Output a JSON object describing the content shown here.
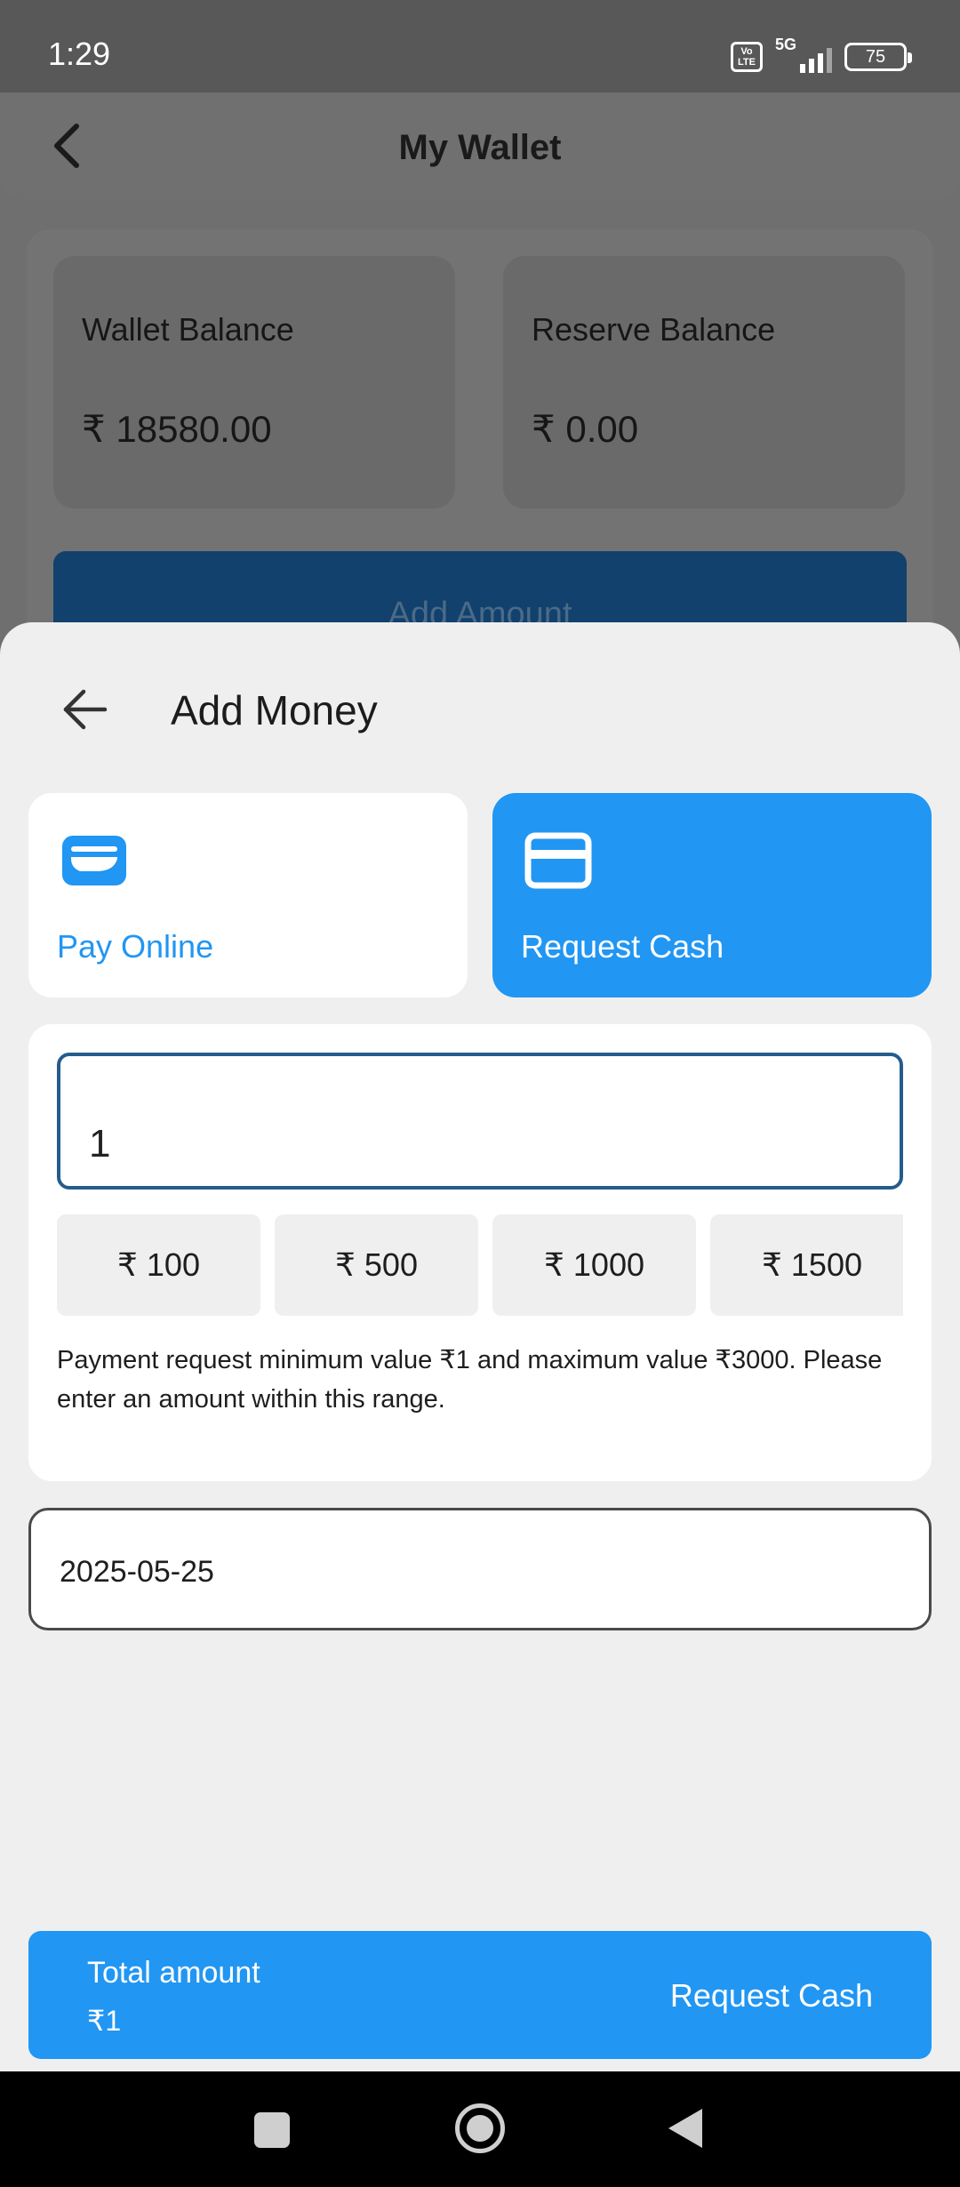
{
  "status_bar": {
    "time": "1:29",
    "volte": "Vo LTE",
    "network": "5G",
    "battery": "75"
  },
  "wallet_page": {
    "title": "My Wallet",
    "wallet_balance_label": "Wallet Balance",
    "wallet_balance_value": "₹ 18580.00",
    "reserve_balance_label": "Reserve Balance",
    "reserve_balance_value": "₹ 0.00",
    "add_amount_label": "Add Amount"
  },
  "sheet": {
    "title": "Add Money",
    "methods": [
      {
        "label": "Pay Online",
        "icon": "wallet-icon",
        "selected": false
      },
      {
        "label": "Request Cash",
        "icon": "card-icon",
        "selected": true
      }
    ],
    "amount_value": "1",
    "quick_amounts": [
      "₹ 100",
      "₹ 500",
      "₹ 1000",
      "₹ 1500"
    ],
    "helper_text": "Payment request minimum value ₹1 and maximum value ₹3000. Please enter an amount within this range.",
    "date_value": "2025-05-25",
    "total_label": "Total amount",
    "total_value": "₹1",
    "submit_label": "Request Cash"
  },
  "colors": {
    "accent": "#2196f3",
    "input_border": "#255c8e",
    "sheet_bg": "#efeff0"
  }
}
